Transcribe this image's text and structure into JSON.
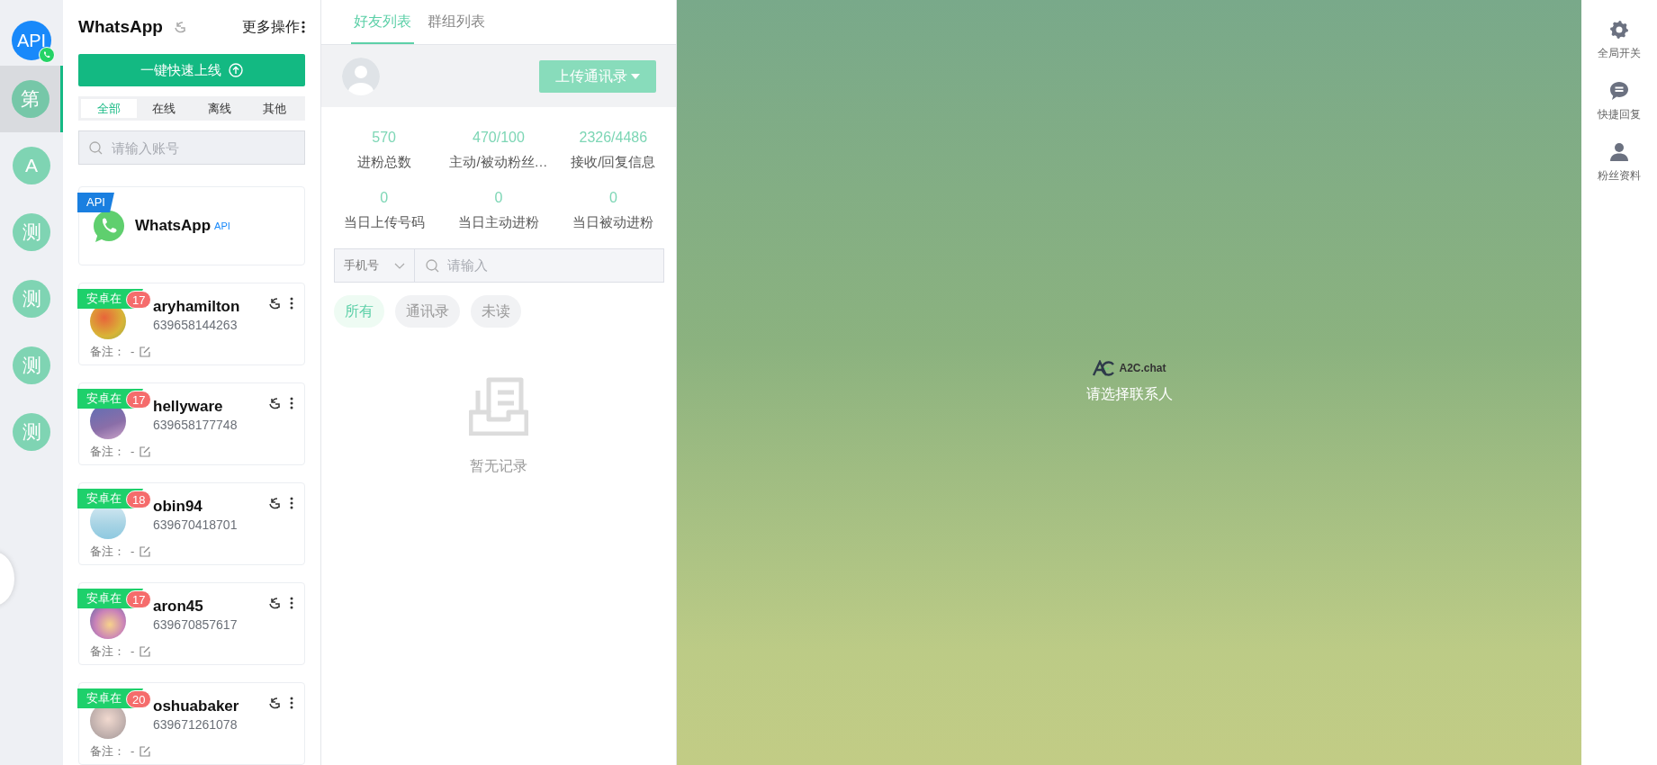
{
  "rail": {
    "items": [
      {
        "label": "API",
        "kind": "api",
        "selected": false
      },
      {
        "label": "第",
        "kind": "letter",
        "selected": true
      },
      {
        "label": "A",
        "kind": "letter",
        "selected": false
      },
      {
        "label": "测",
        "kind": "letter",
        "selected": false
      },
      {
        "label": "测",
        "kind": "letter",
        "selected": false
      },
      {
        "label": "测",
        "kind": "letter",
        "selected": false
      },
      {
        "label": "测",
        "kind": "letter",
        "selected": false
      }
    ]
  },
  "accounts_panel": {
    "title": "WhatsApp",
    "more": "更多操作",
    "online_button": "一键快速上线",
    "filters": [
      {
        "label": "全部",
        "selected": true
      },
      {
        "label": "在线",
        "selected": false
      },
      {
        "label": "离线",
        "selected": false
      },
      {
        "label": "其他",
        "selected": false
      }
    ],
    "search": {
      "placeholder": "请输入账号"
    },
    "api_card": {
      "ribbon": "API",
      "name": "WhatsApp",
      "tag": "API"
    },
    "accounts": [
      {
        "ribbon": "安卓在",
        "count": "17",
        "name": "aryhamilton",
        "phone": "639658144263",
        "note_label": "备注：",
        "note": "-"
      },
      {
        "ribbon": "安卓在",
        "count": "17",
        "name": "hellyware",
        "phone": "639658177748",
        "note_label": "备注：",
        "note": "-"
      },
      {
        "ribbon": "安卓在",
        "count": "18",
        "name": "obin94",
        "phone": "639670418701",
        "note_label": "备注：",
        "note": "-"
      },
      {
        "ribbon": "安卓在",
        "count": "17",
        "name": "aron45",
        "phone": "639670857617",
        "note_label": "备注：",
        "note": "-"
      },
      {
        "ribbon": "安卓在",
        "count": "20",
        "name": "oshuabaker",
        "phone": "639671261078",
        "note_label": "备注：",
        "note": "-"
      }
    ]
  },
  "contacts_panel": {
    "tabs": [
      {
        "label": "好友列表",
        "selected": true
      },
      {
        "label": "群组列表",
        "selected": false
      }
    ],
    "upload_button": "上传通讯录",
    "stats": [
      {
        "value": "570",
        "label": "进粉总数"
      },
      {
        "value": "470/100",
        "label": "主动/被动粉丝…"
      },
      {
        "value": "2326/4486",
        "label": "接收/回复信息"
      },
      {
        "value": "0",
        "label": "当日上传号码"
      },
      {
        "value": "0",
        "label": "当日主动进粉"
      },
      {
        "value": "0",
        "label": "当日被动进粉"
      }
    ],
    "search": {
      "type": "手机号",
      "placeholder": "请输入"
    },
    "filters": [
      {
        "label": "所有",
        "selected": true
      },
      {
        "label": "通讯录",
        "selected": false
      },
      {
        "label": "未读",
        "selected": false
      }
    ],
    "empty_text": "暂无记录"
  },
  "chat": {
    "brand": "A2C.chat",
    "hint": "请选择联系人"
  },
  "right_bar": {
    "items": [
      {
        "kind": "gear",
        "label": "全局开关"
      },
      {
        "kind": "chat",
        "label": "快捷回复"
      },
      {
        "kind": "person",
        "label": "粉丝资料"
      }
    ]
  }
}
